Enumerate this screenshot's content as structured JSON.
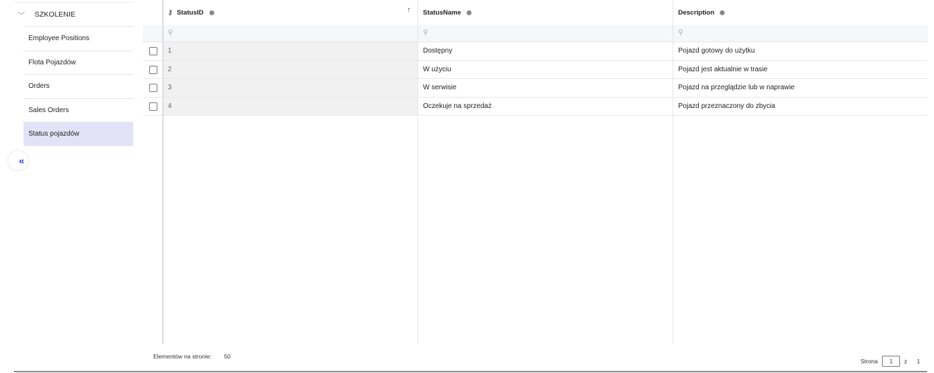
{
  "sidebar": {
    "group": "SZKOLENIE",
    "items": [
      {
        "label": "Employee Positions"
      },
      {
        "label": "Flota Pojazdów"
      },
      {
        "label": "Orders"
      },
      {
        "label": "Sales Orders"
      },
      {
        "label": "Status pojazdów",
        "active": true
      }
    ],
    "collapse_icon": "«"
  },
  "table": {
    "columns": [
      {
        "label": "StatusID",
        "sort": "↑"
      },
      {
        "label": "StatusName"
      },
      {
        "label": "Description"
      }
    ],
    "rows": [
      {
        "id": "1",
        "name": "Dostępny",
        "desc": "Pojazd gotowy do użytku"
      },
      {
        "id": "2",
        "name": "W użyciu",
        "desc": "Pojazd jest aktualnie w trasie"
      },
      {
        "id": "3",
        "name": "W serwisie",
        "desc": "Pojazd na przeglądzie lub w naprawie"
      },
      {
        "id": "4",
        "name": "Oczekuje na sprzedaż",
        "desc": "Pojazd przeznaczony do zbycia"
      }
    ]
  },
  "footer": {
    "page_size_label": "Elementów na stronie:",
    "page_size": "50",
    "page_label": "Strona",
    "page": "1",
    "of_label": "z",
    "total_pages": "1"
  }
}
